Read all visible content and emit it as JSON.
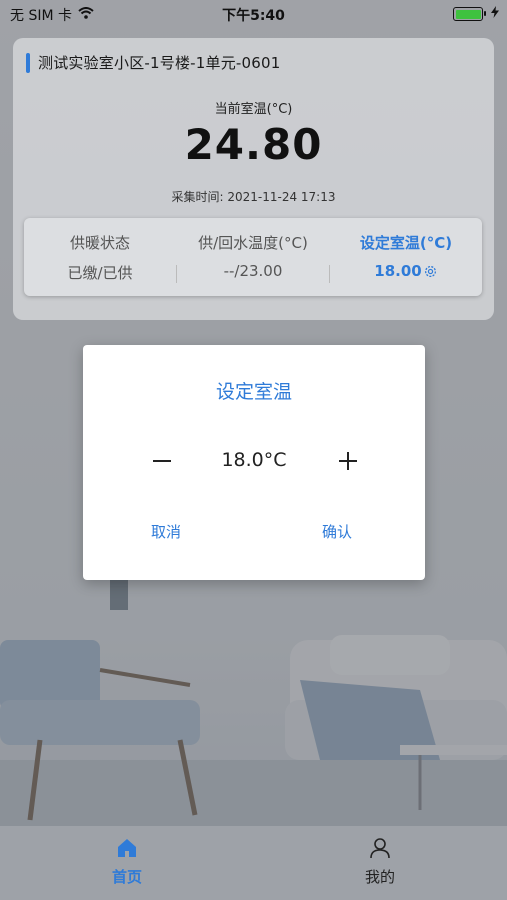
{
  "status_bar": {
    "carrier": "无 SIM 卡",
    "time": "下午5:40"
  },
  "card": {
    "title": "测试实验室小区-1号楼-1单元-0601",
    "current_temp_label": "当前室温(°C)",
    "current_temp_value": "24.80",
    "collect_time": "采集时间: 2021-11-24 17:13"
  },
  "info": {
    "heating_status_label": "供暖状态",
    "heating_status_value": "已缴/已供",
    "water_temp_label": "供/回水温度(°C)",
    "water_temp_value": "--/23.00",
    "set_temp_label": "设定室温(°C)",
    "set_temp_value": "18.00"
  },
  "dialog": {
    "title": "设定室温",
    "value": "18.0°C",
    "cancel_label": "取消",
    "confirm_label": "确认"
  },
  "tabbar": {
    "home_label": "首页",
    "me_label": "我的"
  },
  "colors": {
    "accent": "#2f7bd8",
    "battery": "#3fc23f"
  }
}
